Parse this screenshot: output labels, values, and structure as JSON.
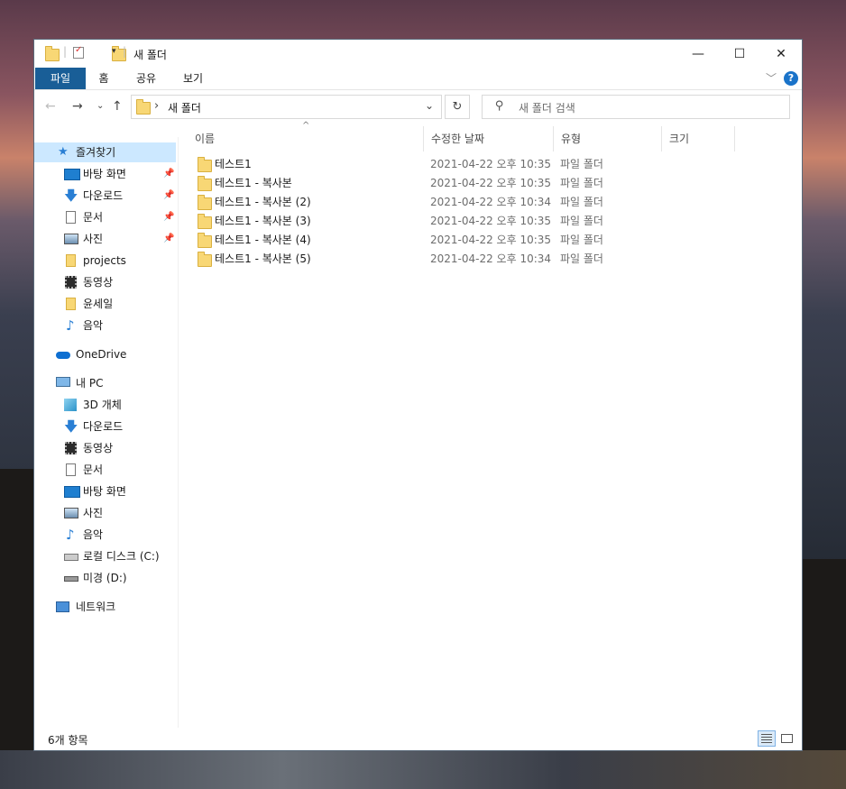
{
  "window": {
    "title": "새 폴더"
  },
  "controls": {
    "minimize": "—",
    "maximize": "☐",
    "close": "✕"
  },
  "ribbon": {
    "tabs": [
      "파일",
      "홈",
      "공유",
      "보기"
    ],
    "help": "?"
  },
  "address": {
    "crumb_sep": "›",
    "path": "새 폴더",
    "search_placeholder": "새 폴더 검색"
  },
  "sidebar": {
    "quick_access": "즐겨찾기",
    "quick_items": [
      {
        "label": "바탕 화면",
        "icon": "desktop-icon",
        "pinned": true
      },
      {
        "label": "다운로드",
        "icon": "download-icon",
        "pinned": true
      },
      {
        "label": "문서",
        "icon": "document-icon",
        "pinned": true
      },
      {
        "label": "사진",
        "icon": "pictures-icon",
        "pinned": true
      },
      {
        "label": "projects",
        "icon": "folder-icon",
        "pinned": false
      },
      {
        "label": "동영상",
        "icon": "video-icon",
        "pinned": false
      },
      {
        "label": "윤세일",
        "icon": "folder-icon",
        "pinned": false
      },
      {
        "label": "음악",
        "icon": "music-icon",
        "pinned": false
      }
    ],
    "onedrive": "OneDrive",
    "this_pc": "내 PC",
    "pc_items": [
      {
        "label": "3D 개체",
        "icon": "3d-objects-icon"
      },
      {
        "label": "다운로드",
        "icon": "download-icon"
      },
      {
        "label": "동영상",
        "icon": "video-icon"
      },
      {
        "label": "문서",
        "icon": "document-icon"
      },
      {
        "label": "바탕 화면",
        "icon": "desktop-icon"
      },
      {
        "label": "사진",
        "icon": "pictures-icon"
      },
      {
        "label": "음악",
        "icon": "music-icon"
      },
      {
        "label": "로컬 디스크 (C:)",
        "icon": "local-disk-icon"
      },
      {
        "label": "미경 (D:)",
        "icon": "drive-icon"
      }
    ],
    "network": "네트워크"
  },
  "columns": [
    "이름",
    "수정한 날짜",
    "유형",
    "크기"
  ],
  "files": [
    {
      "name": "테스트1",
      "date": "2021-04-22 오후 10:35",
      "type": "파일 폴더"
    },
    {
      "name": "테스트1 - 복사본",
      "date": "2021-04-22 오후 10:35",
      "type": "파일 폴더"
    },
    {
      "name": "테스트1 - 복사본 (2)",
      "date": "2021-04-22 오후 10:34",
      "type": "파일 폴더"
    },
    {
      "name": "테스트1 - 복사본 (3)",
      "date": "2021-04-22 오후 10:35",
      "type": "파일 폴더"
    },
    {
      "name": "테스트1 - 복사본 (4)",
      "date": "2021-04-22 오후 10:35",
      "type": "파일 폴더"
    },
    {
      "name": "테스트1 - 복사본 (5)",
      "date": "2021-04-22 오후 10:34",
      "type": "파일 폴더"
    }
  ],
  "status": {
    "count": "6개 항목"
  }
}
